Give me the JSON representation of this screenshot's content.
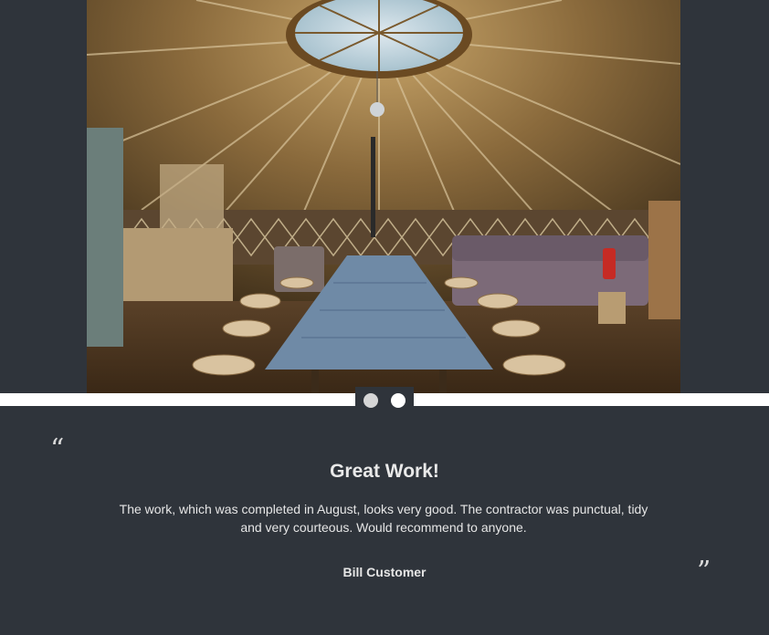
{
  "gallery": {
    "image_alt": "Yurt interior with long table, stools, sofa and kitchen units",
    "slides_total": 2,
    "active_slide_index": 1
  },
  "testimonial": {
    "open_quote": "“",
    "close_quote": "”",
    "title": "Great Work!",
    "body": "The work, which was completed in August, looks very good. The contractor was punctual, tidy and very courteous. Would recommend to anyone.",
    "author": "Bill Customer"
  },
  "colors": {
    "background": "#2f343b",
    "divider": "#ffffff",
    "text": "#e6e6e6"
  }
}
